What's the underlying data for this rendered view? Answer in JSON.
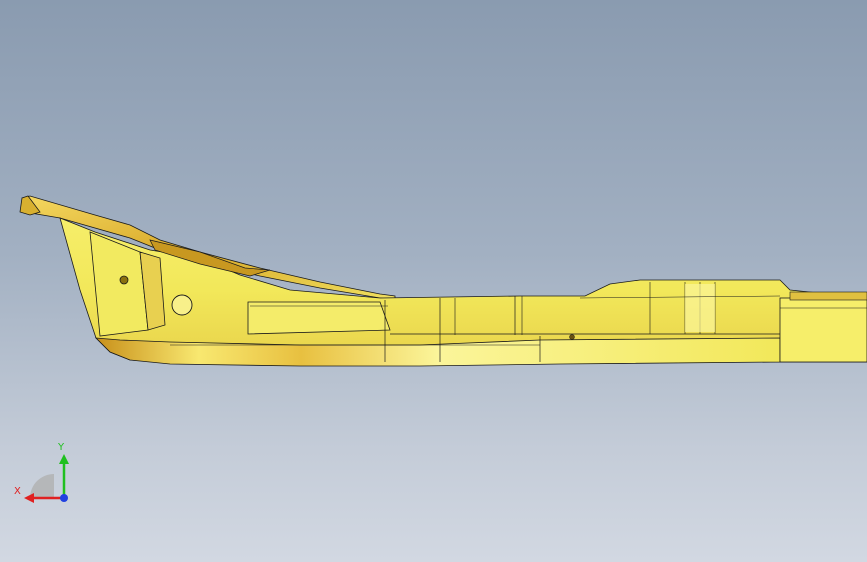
{
  "viewport": {
    "background_top": "#8a9bb0",
    "background_bottom": "#d2d8e2"
  },
  "model": {
    "name_icon": "sheet-metal-rail-part",
    "color_main": "#f2ea5a",
    "color_highlight": "#fbf59a",
    "color_shadow": "#d6a520",
    "edge_color": "#1a1a1a"
  },
  "triad": {
    "x_label": "X",
    "y_label": "Y",
    "x_color": "#e02020",
    "y_color": "#20c020",
    "z_color": "#2040e0"
  }
}
